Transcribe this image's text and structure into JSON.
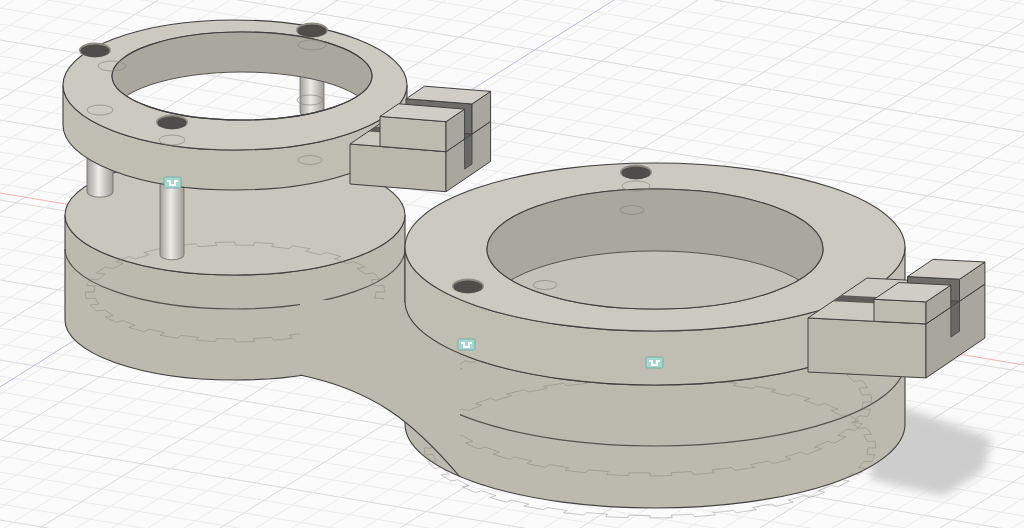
{
  "viewport": {
    "grid": true,
    "model_parts": [
      {
        "kind": "shadow"
      },
      {
        "kind": "base"
      },
      {
        "kind": "post"
      },
      {
        "kind": "post"
      },
      {
        "kind": "post"
      },
      {
        "kind": "ring"
      },
      {
        "kind": "tab"
      },
      {
        "kind": "ring"
      },
      {
        "kind": "tab"
      },
      {
        "kind": "hole"
      },
      {
        "kind": "hole"
      },
      {
        "kind": "hole"
      },
      {
        "kind": "hole"
      },
      {
        "kind": "hole"
      },
      {
        "kind": "joint"
      },
      {
        "kind": "joint"
      },
      {
        "kind": "joint"
      }
    ]
  }
}
